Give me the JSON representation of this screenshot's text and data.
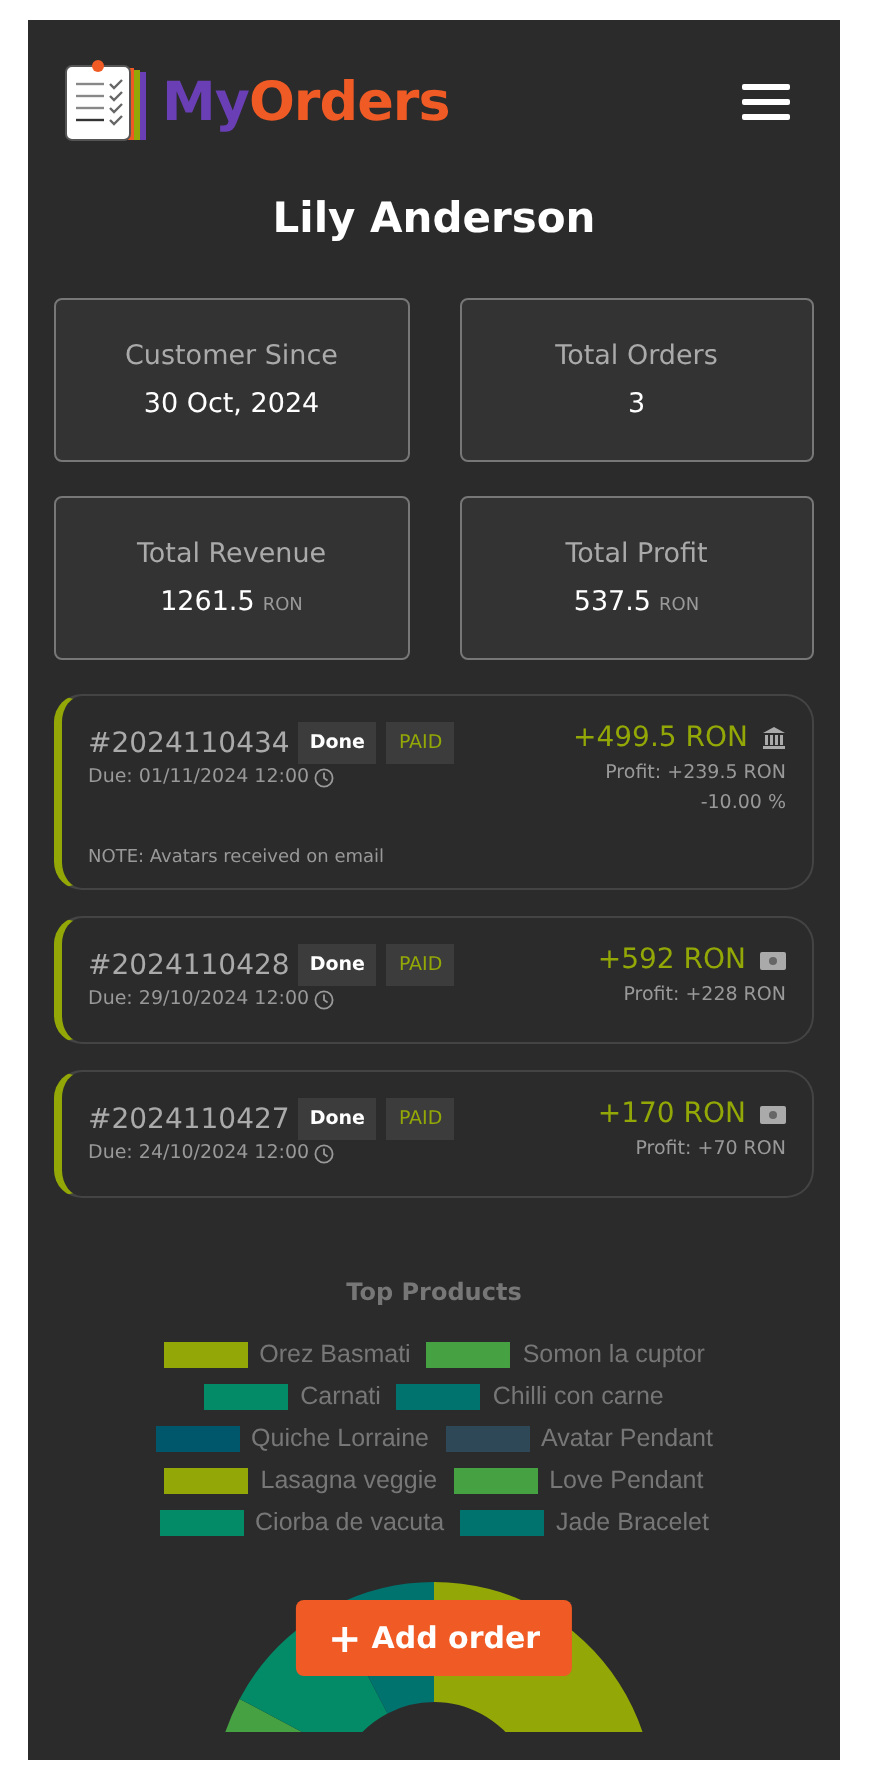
{
  "header": {
    "logo_first": "My",
    "logo_second": "Orders"
  },
  "customer": {
    "name": "Lily Anderson"
  },
  "stats": [
    {
      "label": "Customer Since",
      "value": "30 Oct, 2024"
    },
    {
      "label": "Total Orders",
      "value": "3"
    },
    {
      "label": "Total Revenue",
      "value": "1261.5",
      "unit": "RON"
    },
    {
      "label": "Total Profit",
      "value": "537.5",
      "unit": "RON"
    }
  ],
  "orders": [
    {
      "number": "#2024110434",
      "status": "Done",
      "payment_status": "PAID",
      "due": "Due: 01/11/2024 12:00",
      "amount": "+499.5 RON",
      "kind": "bank",
      "profit": "Profit: +239.5 RON",
      "discount": "-10.00 %",
      "note": "NOTE: Avatars received on email"
    },
    {
      "number": "#2024110428",
      "status": "Done",
      "payment_status": "PAID",
      "due": "Due: 29/10/2024 12:00",
      "amount": "+592 RON",
      "kind": "cash",
      "profit": "Profit: +228 RON"
    },
    {
      "number": "#2024110427",
      "status": "Done",
      "payment_status": "PAID",
      "due": "Due: 24/10/2024 12:00",
      "amount": "+170 RON",
      "kind": "cash",
      "profit": "Profit: +70 RON"
    }
  ],
  "top_products": {
    "title": "Top Products",
    "legend": [
      {
        "label": "Orez Basmati",
        "color": "#93a806"
      },
      {
        "label": "Somon la cuptor",
        "color": "#45a142"
      },
      {
        "label": "Carnati",
        "color": "#038a67"
      },
      {
        "label": "Chilli con carne",
        "color": "#00736f"
      },
      {
        "label": "Quiche Lorraine",
        "color": "#00566a"
      },
      {
        "label": "Avatar Pendant",
        "color": "#2f4858"
      },
      {
        "label": "Lasagna veggie",
        "color": "#93a806"
      },
      {
        "label": "Love Pendant",
        "color": "#45a142"
      },
      {
        "label": "Ciorba de vacuta",
        "color": "#038a67"
      },
      {
        "label": "Jade Bracelet",
        "color": "#00736f"
      }
    ]
  },
  "add_button": {
    "icon": "+",
    "label": "Add order"
  }
}
